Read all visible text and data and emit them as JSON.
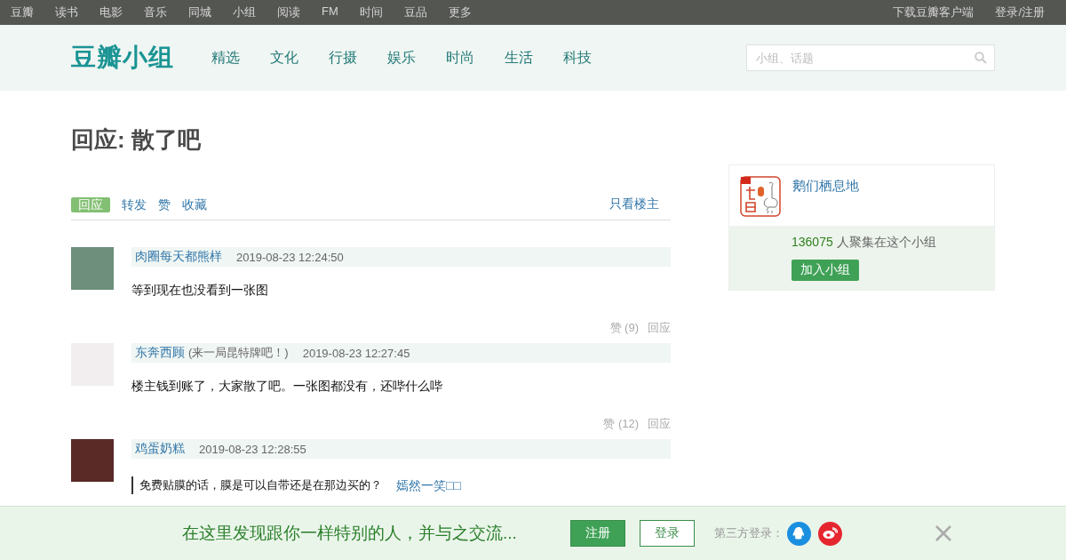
{
  "top_nav": {
    "links": [
      "豆瓣",
      "读书",
      "电影",
      "音乐",
      "同城",
      "小组",
      "阅读",
      "FM",
      "时间",
      "豆品",
      "更多"
    ],
    "right_links": [
      "下载豆瓣客户端",
      "登录/注册"
    ]
  },
  "header": {
    "logo": "豆瓣小组",
    "nav": [
      "精选",
      "文化",
      "行摄",
      "娱乐",
      "时尚",
      "生活",
      "科技"
    ],
    "search": {
      "placeholder": "小组、话题"
    }
  },
  "page_title": "回应: 散了吧",
  "tabs": [
    {
      "label": "回应",
      "selected": true
    },
    {
      "label": "转发",
      "selected": false
    },
    {
      "label": "赞",
      "selected": false
    },
    {
      "label": "收藏",
      "selected": false
    }
  ],
  "filter_link": "只看楼主",
  "comments": [
    {
      "author": "肉圈每天都熊样",
      "time": "2019-08-23 12:24:50",
      "kind": "plain",
      "text": "等到现在也没看到一张图",
      "likes": "赞 (9)",
      "reply": "回应"
    },
    {
      "author": "东奔西顾",
      "signature": "(来一局昆特牌吧！)",
      "time": "2019-08-23 12:27:45",
      "kind": "plain",
      "text": "楼主钱到账了，大家散了吧。一张图都没有，还哔什么哔",
      "likes": "赞 (12)",
      "reply": "回应"
    },
    {
      "author": "鸡蛋奶糕",
      "time": "2019-08-23 12:28:55",
      "kind": "quote",
      "text": "免费贴膜的话，膜是可以自带还是在那边买的？",
      "quote_author": "嫣然一笑□□"
    }
  ],
  "group": {
    "name": "鹅们栖息地",
    "member_count": "136075",
    "member_text": "人聚集在这个小组",
    "join": "加入小组"
  },
  "banner": {
    "text": "在这里发现跟你一样特别的人，并与之交流...",
    "register": "注册",
    "login": "登录",
    "third_party": "第三方登录："
  }
}
